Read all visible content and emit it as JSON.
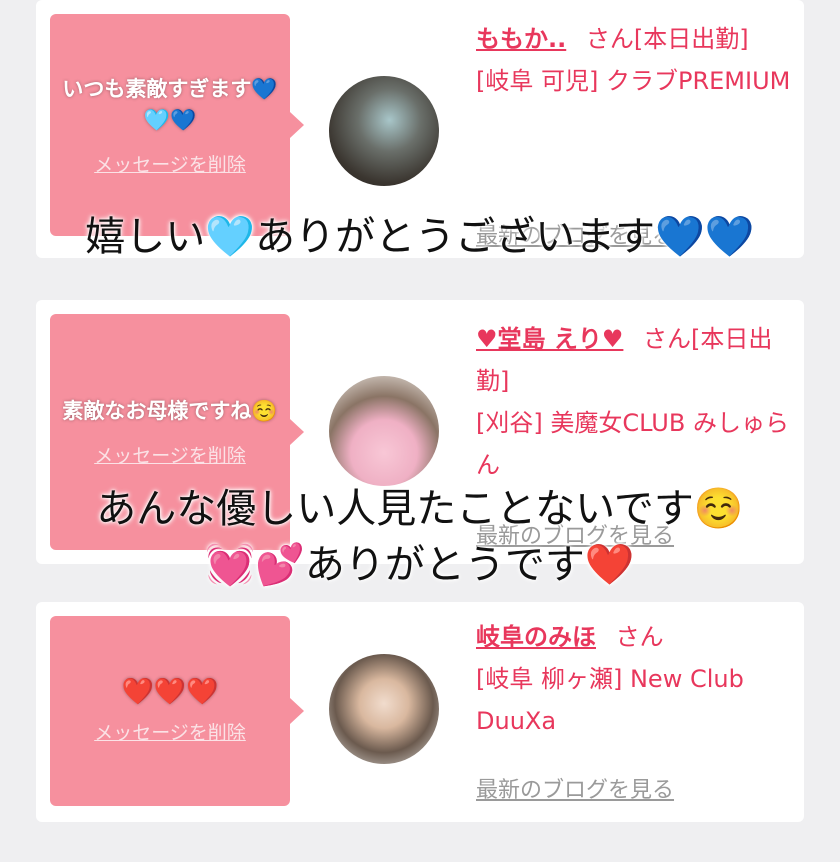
{
  "cards": [
    {
      "message": "いつも素敵すぎます💙🩵💙",
      "delete_label": "メッセージを削除",
      "name": "ももか..",
      "suffix": "さん",
      "detail_1": "[本日出勤]",
      "detail_2": "[岐阜 可児] クラブPREMIUM",
      "blog_label": "最新のブログを見る"
    },
    {
      "message": "素敵なお母様ですね☺️",
      "delete_label": "メッセージを削除",
      "name": "♥堂島 えり♥",
      "suffix": "さん",
      "detail_1": "[本日出勤]",
      "detail_2": "[刈谷] 美魔女CLUB みしゅらん",
      "blog_label": "最新のブログを見る"
    },
    {
      "message": "❤️❤️❤️",
      "delete_label": "メッセージを削除",
      "name": "岐阜のみほ",
      "suffix": "さん",
      "detail_1": "",
      "detail_2": "[岐阜 柳ヶ瀬] New Club DuuXa",
      "blog_label": "最新のブログを見る"
    }
  ],
  "overlay": {
    "line_1": "嬉しい🩵ありがとうございます💙💙",
    "line_2": "あんな優しい人見たことないです☺️",
    "line_3": "💓💕ありがとうです❤️"
  }
}
